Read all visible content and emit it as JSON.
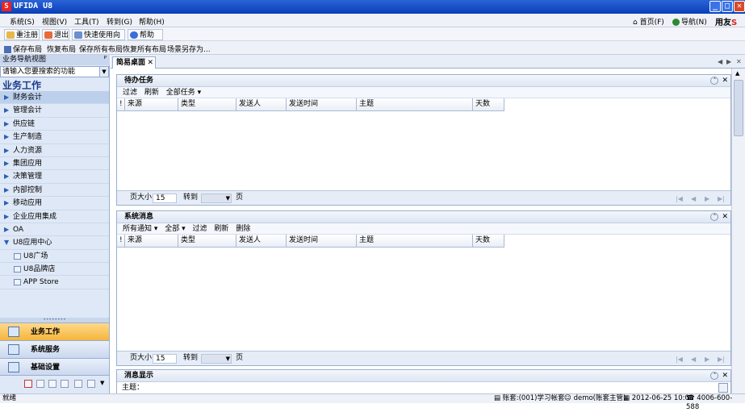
{
  "titlebar": {
    "logo": "S",
    "title": "UFIDA U8",
    "min": "_",
    "max": "□",
    "close": "✕"
  },
  "menubar": {
    "items": [
      "系统(S)",
      "视图(V)",
      "工具(T)",
      "转到(G)",
      "帮助(H)"
    ],
    "home": "首页(F)",
    "nav": "导航(N)",
    "brand": "用友"
  },
  "toolbar1": {
    "items": [
      "重注册",
      "退出",
      "快速使用向导",
      "帮助(H)"
    ]
  },
  "toolbar2": {
    "items": [
      "保存布局",
      "恢复布局",
      "保存所有布局",
      "恢复所有布局",
      "场景另存为..."
    ]
  },
  "left": {
    "header": "业务导航视图",
    "pin": "ᴾ",
    "search_placeholder": "请输入您要搜索的功能",
    "title": "业务工作",
    "nav_items": [
      "财务会计",
      "管理会计",
      "供应链",
      "生产制造",
      "人力资源",
      "集团应用",
      "决策管理",
      "内部控制",
      "移动应用",
      "企业应用集成",
      "OA",
      "U8应用中心"
    ],
    "sub_items": [
      "U8广场",
      "U8品牌店",
      "APP Store"
    ],
    "modules": [
      "业务工作",
      "系统服务",
      "基础设置"
    ]
  },
  "tab": {
    "label": "简易桌面",
    "close": "✕"
  },
  "tasks": {
    "title": "待办任务",
    "toolbar": [
      "过滤",
      "刷新",
      "全部任务 ▾"
    ],
    "columns": [
      "!",
      "来源",
      "类型",
      "发送人",
      "发送时间",
      "主题",
      "天数"
    ],
    "page_size_label": "页大小",
    "page_size": "15",
    "goto_label": "转到",
    "page_label": "页"
  },
  "messages": {
    "title": "系统消息",
    "toolbar": [
      "所有通知 ▾",
      "全部 ▾",
      "过滤",
      "刷新",
      "删除"
    ],
    "columns": [
      "!",
      "来源",
      "类型",
      "发送人",
      "发送时间",
      "主题",
      "天数"
    ],
    "page_size_label": "页大小",
    "page_size": "15",
    "goto_label": "转到",
    "page_label": "页"
  },
  "display": {
    "title": "消息显示",
    "subject_label": "主题："
  },
  "status": {
    "ready": "就绪",
    "account": "账套:(001)学习帐套",
    "user": "demo(账套主管)",
    "datetime": "2012-06-25 10:08",
    "phone": "4006-600-588"
  }
}
